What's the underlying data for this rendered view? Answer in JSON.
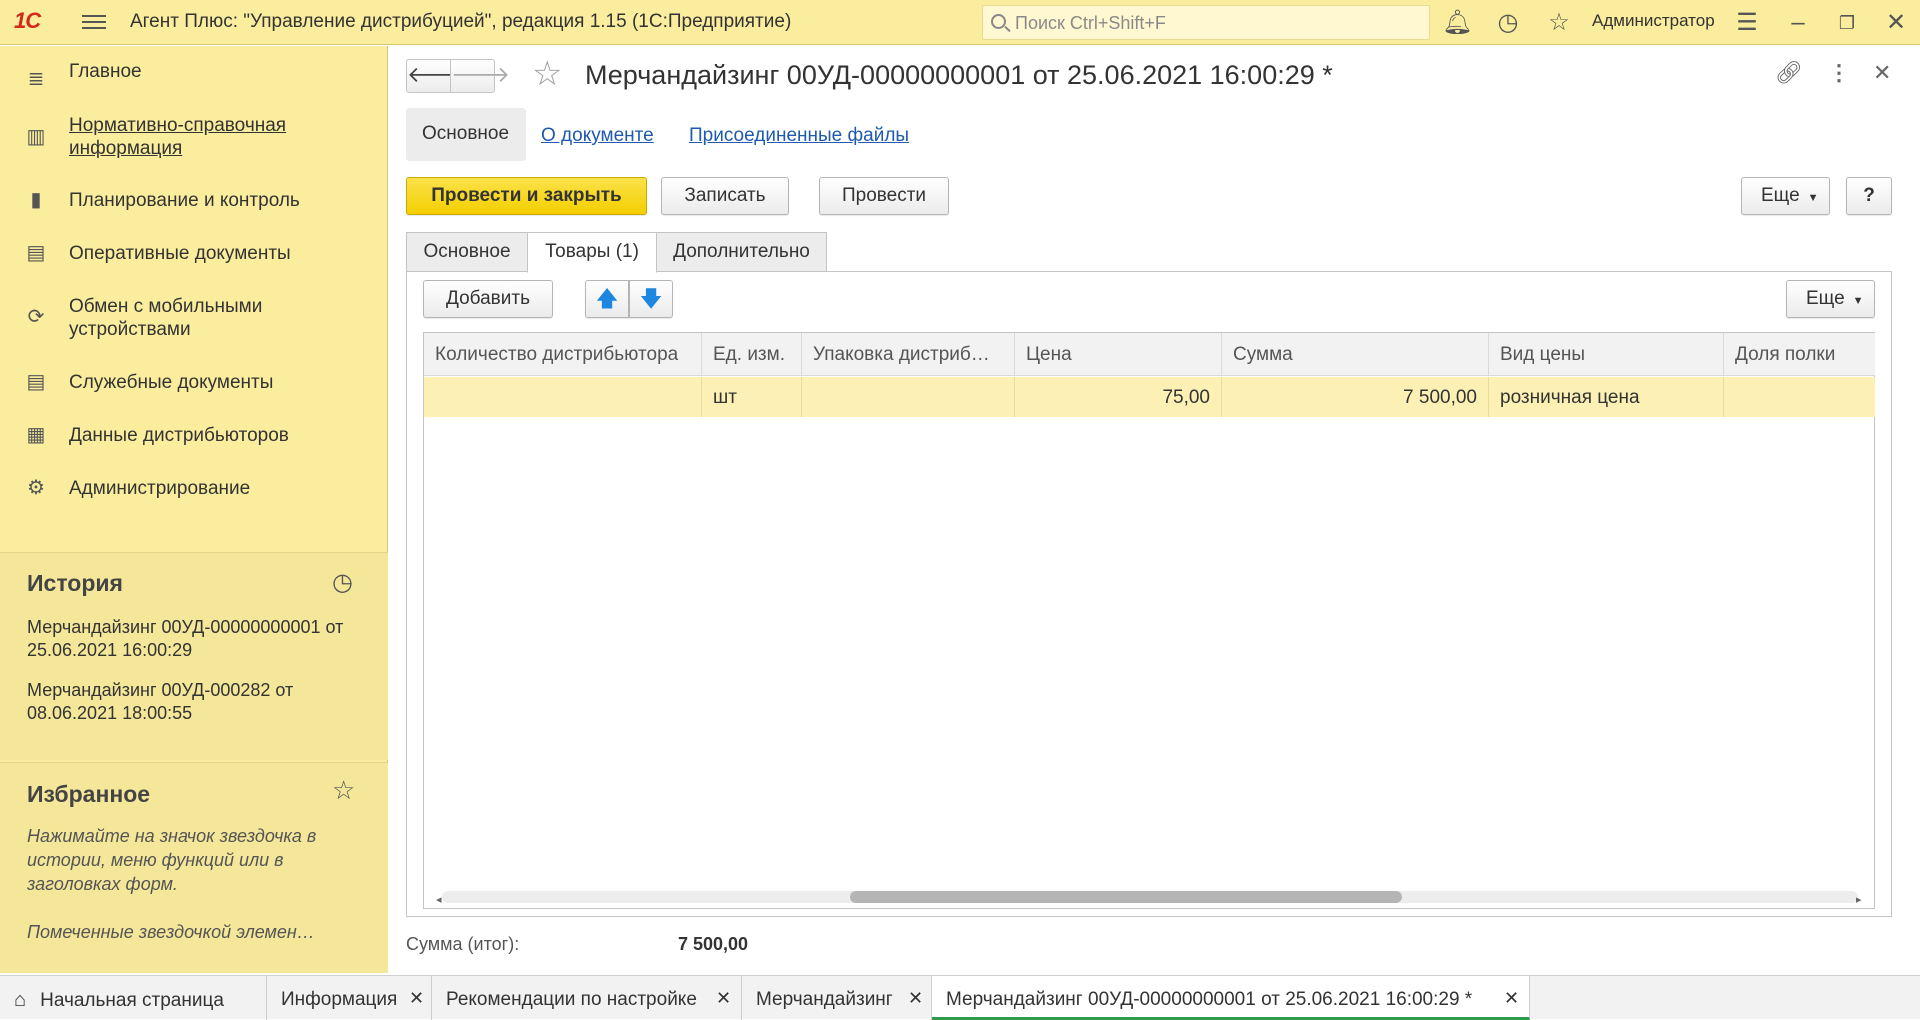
{
  "app": {
    "logo": "1С",
    "title": "Агент Плюс: \"Управление дистрибуцией\", редакция 1.15  (1С:Предприятие)",
    "search_placeholder": "Поиск Ctrl+Shift+F",
    "user": "Администратор"
  },
  "sidebar": {
    "items": [
      {
        "label": "Главное",
        "icon": "list-icon"
      },
      {
        "label": "Нормативно-справочная информация",
        "icon": "catalog-icon"
      },
      {
        "label": "Планирование и контроль",
        "icon": "chart-icon"
      },
      {
        "label": "Оперативные документы",
        "icon": "documents-icon"
      },
      {
        "label": "Обмен с мобильными устройствами",
        "icon": "sync-icon"
      },
      {
        "label": "Служебные документы",
        "icon": "service-docs-icon"
      },
      {
        "label": "Данные дистрибьюторов",
        "icon": "distributor-data-icon"
      },
      {
        "label": "Администрирование",
        "icon": "gear-icon"
      }
    ]
  },
  "history": {
    "title": "История",
    "items": [
      "Мерчандайзинг 00УД-00000000001 от 25.06.2021 16:00:29",
      "Мерчандайзинг 00УД-000282 от 08.06.2021 18:00:55"
    ]
  },
  "favorites": {
    "title": "Избранное",
    "hint": "Нажимайте на значок звездочка в истории, меню функций или в заголовках форм.",
    "hint2": "Помеченные звездочкой элемен…"
  },
  "form": {
    "title": "Мерчандайзинг 00УД-00000000001 от 25.06.2021 16:00:29 *",
    "sections": [
      "Основное",
      "О документе",
      "Присоединенные файлы"
    ],
    "buttons": {
      "post_close": "Провести и закрыть",
      "save": "Записать",
      "post": "Провести",
      "more": "Еще",
      "help": "?"
    },
    "tabs": [
      "Основное",
      "Товары (1)",
      "Дополнительно"
    ],
    "table_toolbar": {
      "add": "Добавить",
      "more": "Еще"
    },
    "table": {
      "columns": [
        "Количество дистрибьютора",
        "Ед. изм.",
        "Упаковка дистриб…",
        "Цена",
        "Сумма",
        "Вид цены",
        "Доля полки"
      ],
      "rows": [
        [
          "",
          "шт",
          "",
          "75,00",
          "7 500,00",
          "розничная цена",
          ""
        ]
      ]
    },
    "total_label": "Сумма (итог):",
    "total_value": "7 500,00"
  },
  "bottom_tabs": [
    {
      "label": "Начальная страница",
      "closable": false
    },
    {
      "label": "Информация",
      "closable": true
    },
    {
      "label": "Рекомендации по настройке",
      "closable": true
    },
    {
      "label": "Мерчандайзинг",
      "closable": true
    },
    {
      "label": "Мерчандайзинг 00УД-00000000001 от 25.06.2021 16:00:29 *",
      "closable": true,
      "active": true
    }
  ]
}
